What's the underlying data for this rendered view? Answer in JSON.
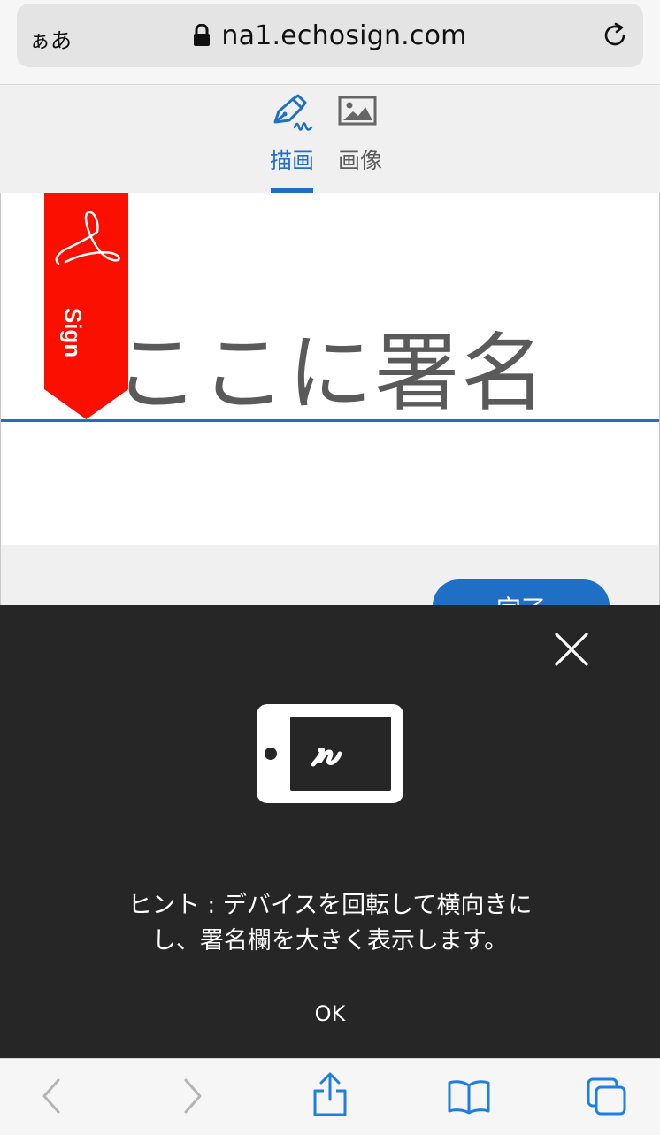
{
  "browser": {
    "text_size_label": "ぁあ",
    "url": "na1.echosign.com"
  },
  "tabs": [
    {
      "label": "描画",
      "icon": "pen-signature-icon",
      "active": true
    },
    {
      "label": "画像",
      "icon": "image-icon",
      "active": false
    }
  ],
  "signature": {
    "placeholder": "ここに署名",
    "flag_label": "Sign",
    "done_label": "完了"
  },
  "hint": {
    "line1": "ヒント : デバイスを回転して横向きに",
    "line2": "し、署名欄を大きく表示します。",
    "ok_label": "OK"
  },
  "colors": {
    "accent": "#1f6fc5",
    "flag_red": "#fa0f00",
    "overlay": "#262626"
  }
}
